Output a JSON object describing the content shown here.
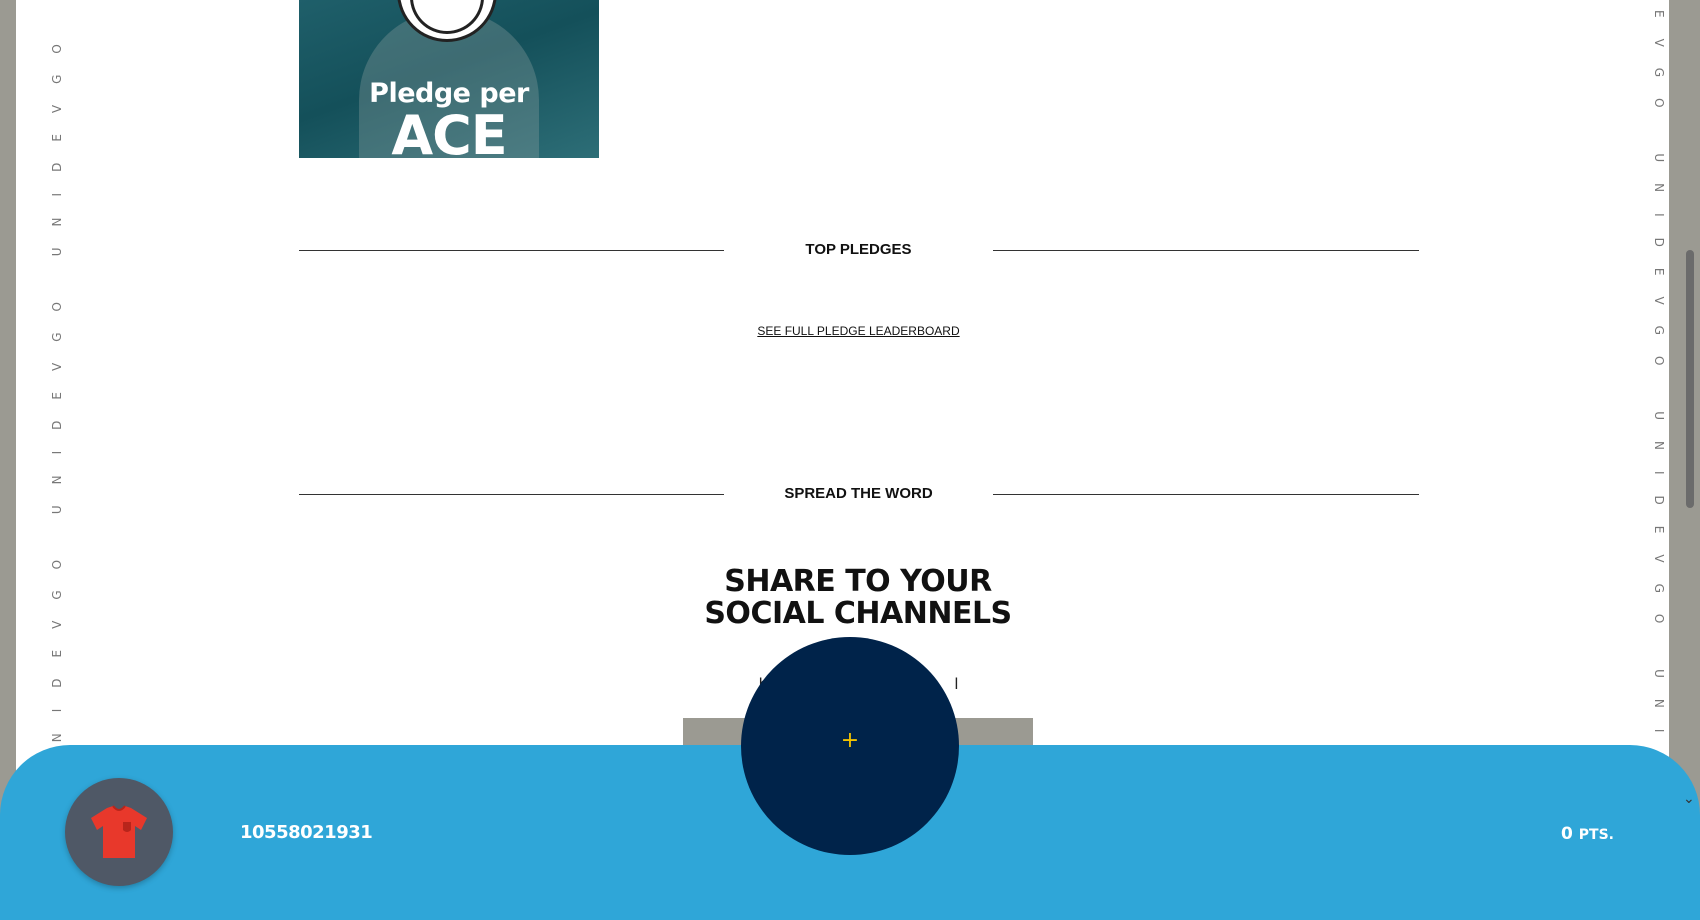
{
  "sidebar": {
    "left_text": "UNIDEVGO UNIDEVGO UNIDEVGO UNIDEVGO UNIDEVGO",
    "right_text": "EVGO UNIDEVGO UNIDEVGO UNIDEVGO UNI"
  },
  "hero": {
    "line1": "Pledge per",
    "line2": "ACE"
  },
  "sections": {
    "top_pledges": "TOP PLEDGES",
    "leaderboard_link": "SEE FULL PLEDGE LEADERBOARD",
    "spread": "SPREAD THE WORD"
  },
  "share": {
    "title_line1": "SHARE TO YOUR",
    "title_line2": "SOCIAL CHANNELS",
    "subtitle_left": "by",
    "subtitle_right": "l"
  },
  "footer": {
    "user_id": "10558021931",
    "points_value": "0",
    "points_label": "PTS."
  },
  "fab": {
    "icon": "plus-icon",
    "glyph": "+"
  },
  "colors": {
    "footer_bg": "#2fa6d8",
    "fab_bg": "#00234a",
    "fab_icon": "#f2c200",
    "avatar_bg": "#4f5866",
    "jersey": "#e8382b"
  }
}
